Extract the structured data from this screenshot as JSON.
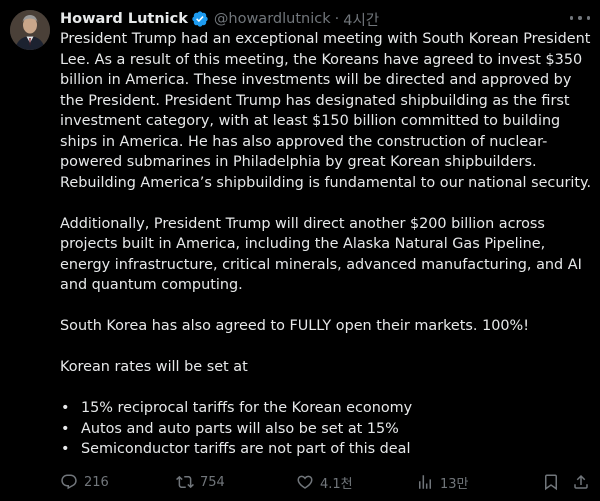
{
  "author": {
    "name": "Howard Lutnick",
    "handle": "@howardlutnick",
    "separator": "·",
    "time": "4시간"
  },
  "colors": {
    "background": "#000000",
    "text": "#e7e9ea",
    "muted": "#71767b",
    "verified": "#1d9bf0"
  },
  "body": {
    "p1": "President Trump had an exceptional meeting with South Korean President Lee. As a result of this meeting, the Koreans have agreed to invest $350 billion in America. These investments will be directed and approved by the President. President Trump has designated shipbuilding as the first investment category, with at least $150 billion committed to building ships in America. He has also approved the construction of nuclear-powered submarines in Philadelphia by great Korean shipbuilders. Rebuilding America’s shipbuilding is fundamental to our national security.",
    "p2": "Additionally, President Trump will direct another $200 billion across projects built in America, including the Alaska Natural Gas Pipeline, energy infrastructure, critical minerals, advanced manufacturing, and AI and quantum computing.",
    "p3": "South Korea has also agreed to FULLY open their markets. 100%!",
    "p4": "Korean rates will be set at",
    "bullets": [
      " 15% reciprocal tariffs for the Korean economy",
      "Autos and auto parts will also be set at 15%",
      "Semiconductor tariffs are not part of this deal"
    ]
  },
  "actions": {
    "reply": {
      "icon": "reply-icon",
      "count": "216"
    },
    "repost": {
      "icon": "repost-icon",
      "count": "754"
    },
    "like": {
      "icon": "heart-icon",
      "count": "4.1천"
    },
    "views": {
      "icon": "views-icon",
      "count": "13만"
    },
    "bookmark": {
      "icon": "bookmark-icon"
    },
    "share": {
      "icon": "share-icon"
    }
  }
}
